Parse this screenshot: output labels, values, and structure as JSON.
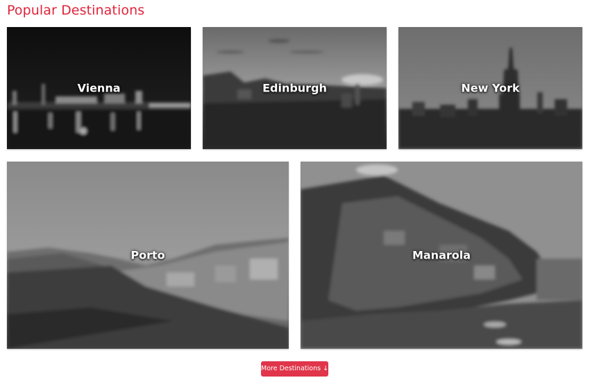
{
  "section": {
    "title": "Popular Destinations"
  },
  "destinations": [
    {
      "name": "Vienna"
    },
    {
      "name": "Edinburgh"
    },
    {
      "name": "New York"
    },
    {
      "name": "Porto"
    },
    {
      "name": "Manarola"
    }
  ],
  "more_button": {
    "label": "More Destinations",
    "icon": "arrow-down-icon",
    "icon_glyph": "↓"
  },
  "colors": {
    "accent": "#e0243a",
    "button": "#e0354a"
  }
}
